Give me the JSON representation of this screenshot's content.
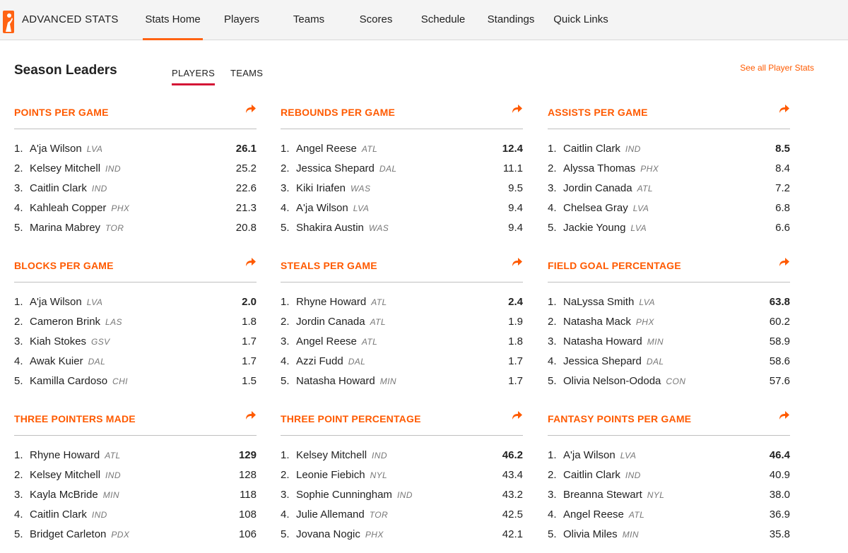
{
  "header": {
    "brand": "ADVANCED STATS",
    "nav": [
      "Stats Home",
      "Players",
      "Teams",
      "Scores",
      "Schedule",
      "Standings",
      "Quick Links"
    ],
    "active_nav": "Stats Home"
  },
  "leaders": {
    "title": "Season Leaders",
    "tabs": [
      "PLAYERS",
      "TEAMS"
    ],
    "active_tab": "PLAYERS",
    "see_all": "See all Player Stats"
  },
  "colors": {
    "accent": "#ff5a00",
    "tab_underline": "#d41535"
  },
  "categories": [
    {
      "title": "POINTS PER GAME",
      "rows": [
        {
          "rank": "1.",
          "name": "A'ja Wilson",
          "team": "LVA",
          "value": "26.1"
        },
        {
          "rank": "2.",
          "name": "Kelsey Mitchell",
          "team": "IND",
          "value": "25.2"
        },
        {
          "rank": "3.",
          "name": "Caitlin Clark",
          "team": "IND",
          "value": "22.6"
        },
        {
          "rank": "4.",
          "name": "Kahleah Copper",
          "team": "PHX",
          "value": "21.3"
        },
        {
          "rank": "5.",
          "name": "Marina Mabrey",
          "team": "TOR",
          "value": "20.8"
        }
      ]
    },
    {
      "title": "REBOUNDS PER GAME",
      "rows": [
        {
          "rank": "1.",
          "name": "Angel Reese",
          "team": "ATL",
          "value": "12.4"
        },
        {
          "rank": "2.",
          "name": "Jessica Shepard",
          "team": "DAL",
          "value": "11.1"
        },
        {
          "rank": "3.",
          "name": "Kiki Iriafen",
          "team": "WAS",
          "value": "9.5"
        },
        {
          "rank": "4.",
          "name": "A'ja Wilson",
          "team": "LVA",
          "value": "9.4"
        },
        {
          "rank": "5.",
          "name": "Shakira Austin",
          "team": "WAS",
          "value": "9.4"
        }
      ]
    },
    {
      "title": "ASSISTS PER GAME",
      "rows": [
        {
          "rank": "1.",
          "name": "Caitlin Clark",
          "team": "IND",
          "value": "8.5"
        },
        {
          "rank": "2.",
          "name": "Alyssa Thomas",
          "team": "PHX",
          "value": "8.4"
        },
        {
          "rank": "3.",
          "name": "Jordin Canada",
          "team": "ATL",
          "value": "7.2"
        },
        {
          "rank": "4.",
          "name": "Chelsea Gray",
          "team": "LVA",
          "value": "6.8"
        },
        {
          "rank": "5.",
          "name": "Jackie Young",
          "team": "LVA",
          "value": "6.6"
        }
      ]
    },
    {
      "title": "BLOCKS PER GAME",
      "rows": [
        {
          "rank": "1.",
          "name": "A'ja Wilson",
          "team": "LVA",
          "value": "2.0"
        },
        {
          "rank": "2.",
          "name": "Cameron Brink",
          "team": "LAS",
          "value": "1.8"
        },
        {
          "rank": "3.",
          "name": "Kiah Stokes",
          "team": "GSV",
          "value": "1.7"
        },
        {
          "rank": "4.",
          "name": "Awak Kuier",
          "team": "DAL",
          "value": "1.7"
        },
        {
          "rank": "5.",
          "name": "Kamilla Cardoso",
          "team": "CHI",
          "value": "1.5"
        }
      ]
    },
    {
      "title": "STEALS PER GAME",
      "rows": [
        {
          "rank": "1.",
          "name": "Rhyne Howard",
          "team": "ATL",
          "value": "2.4"
        },
        {
          "rank": "2.",
          "name": "Jordin Canada",
          "team": "ATL",
          "value": "1.9"
        },
        {
          "rank": "3.",
          "name": "Angel Reese",
          "team": "ATL",
          "value": "1.8"
        },
        {
          "rank": "4.",
          "name": "Azzi Fudd",
          "team": "DAL",
          "value": "1.7"
        },
        {
          "rank": "5.",
          "name": "Natasha Howard",
          "team": "MIN",
          "value": "1.7"
        }
      ]
    },
    {
      "title": "FIELD GOAL PERCENTAGE",
      "rows": [
        {
          "rank": "1.",
          "name": "NaLyssa Smith",
          "team": "LVA",
          "value": "63.8"
        },
        {
          "rank": "2.",
          "name": "Natasha Mack",
          "team": "PHX",
          "value": "60.2"
        },
        {
          "rank": "3.",
          "name": "Natasha Howard",
          "team": "MIN",
          "value": "58.9"
        },
        {
          "rank": "4.",
          "name": "Jessica Shepard",
          "team": "DAL",
          "value": "58.6"
        },
        {
          "rank": "5.",
          "name": "Olivia Nelson-Ododa",
          "team": "CON",
          "value": "57.6"
        }
      ]
    },
    {
      "title": "THREE POINTERS MADE",
      "rows": [
        {
          "rank": "1.",
          "name": "Rhyne Howard",
          "team": "ATL",
          "value": "129"
        },
        {
          "rank": "2.",
          "name": "Kelsey Mitchell",
          "team": "IND",
          "value": "128"
        },
        {
          "rank": "3.",
          "name": "Kayla McBride",
          "team": "MIN",
          "value": "118"
        },
        {
          "rank": "4.",
          "name": "Caitlin Clark",
          "team": "IND",
          "value": "108"
        },
        {
          "rank": "5.",
          "name": "Bridget Carleton",
          "team": "PDX",
          "value": "106"
        }
      ]
    },
    {
      "title": "THREE POINT PERCENTAGE",
      "rows": [
        {
          "rank": "1.",
          "name": "Kelsey Mitchell",
          "team": "IND",
          "value": "46.2"
        },
        {
          "rank": "2.",
          "name": "Leonie Fiebich",
          "team": "NYL",
          "value": "43.4"
        },
        {
          "rank": "3.",
          "name": "Sophie Cunningham",
          "team": "IND",
          "value": "43.2"
        },
        {
          "rank": "4.",
          "name": "Julie Allemand",
          "team": "TOR",
          "value": "42.5"
        },
        {
          "rank": "5.",
          "name": "Jovana Nogic",
          "team": "PHX",
          "value": "42.1"
        }
      ]
    },
    {
      "title": "FANTASY POINTS PER GAME",
      "rows": [
        {
          "rank": "1.",
          "name": "A'ja Wilson",
          "team": "LVA",
          "value": "46.4"
        },
        {
          "rank": "2.",
          "name": "Caitlin Clark",
          "team": "IND",
          "value": "40.9"
        },
        {
          "rank": "3.",
          "name": "Breanna Stewart",
          "team": "NYL",
          "value": "38.0"
        },
        {
          "rank": "4.",
          "name": "Angel Reese",
          "team": "ATL",
          "value": "36.9"
        },
        {
          "rank": "5.",
          "name": "Olivia Miles",
          "team": "MIN",
          "value": "35.8"
        }
      ]
    }
  ]
}
